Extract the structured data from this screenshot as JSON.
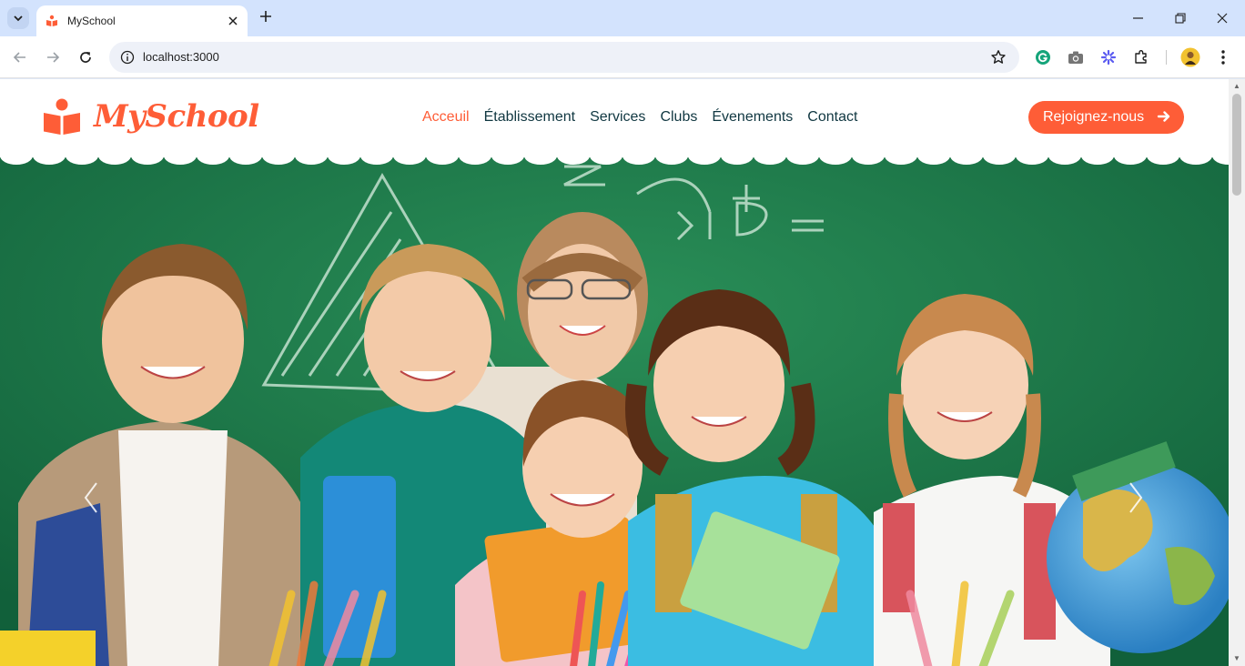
{
  "browser": {
    "tab_title": "MySchool",
    "url": "localhost:3000"
  },
  "site": {
    "logo_text": "MySchool",
    "nav": [
      {
        "label": "Acceuil",
        "active": true
      },
      {
        "label": "Établissement",
        "active": false
      },
      {
        "label": "Services",
        "active": false
      },
      {
        "label": "Clubs",
        "active": false
      },
      {
        "label": "Évenements",
        "active": false
      },
      {
        "label": "Contact",
        "active": false
      }
    ],
    "cta_label": "Rejoignez-nous"
  },
  "colors": {
    "brand": "#fe5d37",
    "nav_text": "#103741",
    "chalkboard": "#1d7a47"
  },
  "icons": [
    "tab-search-icon",
    "favicon-icon",
    "close-icon",
    "new-tab-icon",
    "minimize-icon",
    "restore-icon",
    "window-close-icon",
    "back-icon",
    "forward-icon",
    "reload-icon",
    "site-info-icon",
    "bookmark-star-icon",
    "grammarly-icon",
    "camera-icon",
    "extension-flower-icon",
    "extensions-puzzle-icon",
    "profile-avatar-icon",
    "menu-dots-icon",
    "logo-book-icon",
    "arrow-right-icon",
    "chevron-left-icon",
    "chevron-right-icon"
  ]
}
